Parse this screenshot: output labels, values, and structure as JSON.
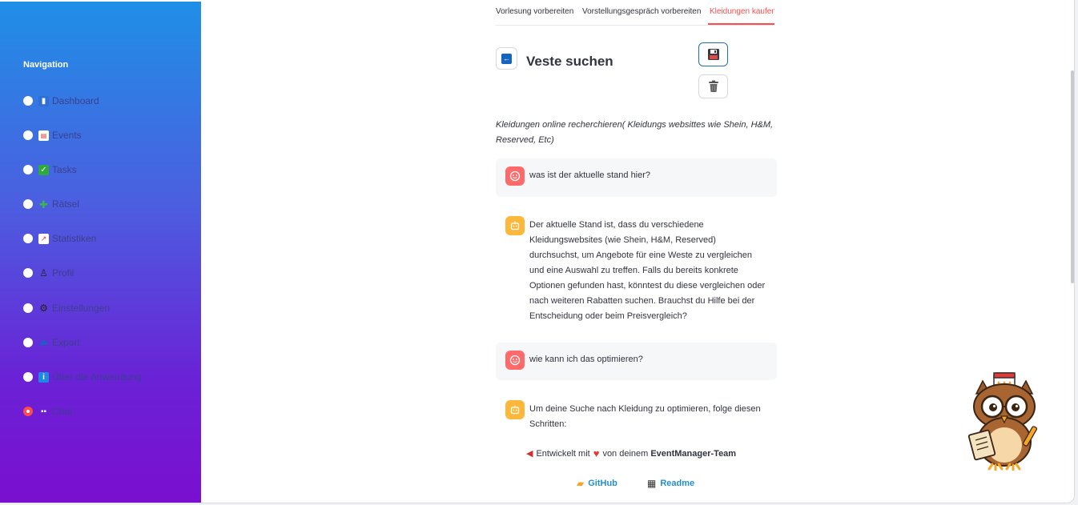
{
  "sidebar": {
    "title": "Navigation",
    "items": [
      {
        "icon": "chart-icon",
        "emoji": "📊",
        "label": "Dashboard",
        "selected": false
      },
      {
        "icon": "calendar-icon",
        "emoji": "📅",
        "label": "Events",
        "selected": false
      },
      {
        "icon": "checkmark-icon",
        "emoji": "✅",
        "label": "Tasks",
        "selected": false
      },
      {
        "icon": "puzzle-icon",
        "emoji": "🧩",
        "label": "Rätsel",
        "selected": false
      },
      {
        "icon": "trend-chart-icon",
        "emoji": "📈",
        "label": "Statistiken",
        "selected": false
      },
      {
        "icon": "user-icon",
        "emoji": "👤",
        "label": "Profil",
        "selected": false
      },
      {
        "icon": "gear-icon",
        "emoji": "⚙",
        "label": "Einstellungen",
        "selected": false
      },
      {
        "icon": "export-icon",
        "emoji": "📤",
        "label": "Export",
        "selected": false
      },
      {
        "icon": "info-icon",
        "emoji": "ℹ",
        "label": "Über die Anwendung",
        "selected": false
      },
      {
        "icon": "chat-icon",
        "emoji": "💬",
        "label": "Chat",
        "selected": true
      }
    ]
  },
  "tabs": [
    {
      "label": "Vorlesung vorbereiten",
      "active": false
    },
    {
      "label": "Vorstellungsgespräch vorbereiten",
      "active": false
    },
    {
      "label": "Kleidungen kaufen",
      "active": true
    }
  ],
  "task": {
    "back_icon": "back-arrow-icon",
    "title": "Veste suchen",
    "description": "Kleidungen online recherchieren( Kleidungs websittes wie Shein, H&M, Reserved, Etc)"
  },
  "chat": {
    "messages": [
      {
        "role": "user",
        "text": "was ist der aktuelle stand hier?"
      },
      {
        "role": "assistant",
        "text": "Der aktuelle Stand ist, dass du verschiedene Kleidungswebsites (wie Shein, H&M, Reserved) durchsuchst, um Angebote für eine Weste zu vergleichen und eine Auswahl zu treffen. Falls du bereits konkrete Optionen gefunden hast, könntest du diese vergleichen oder nach weiteren Rabatten suchen. Brauchst du Hilfe bei der Entscheidung oder beim Preisvergleich?"
      },
      {
        "role": "user",
        "text": "wie kann ich das optimieren?"
      },
      {
        "role": "assistant",
        "text": "Um deine Suche nach Kleidung zu optimieren, folge diesen Schritten:"
      }
    ]
  },
  "footer": {
    "prefix": "Entwickelt mit",
    "middle": "von deinem",
    "team": "EventManager-Team",
    "github": "GitHub",
    "readme": "Readme"
  },
  "colors": {
    "accent": "#ff4b4b",
    "link": "#1f8fd1",
    "sidebar_top": "#1f8fe6",
    "sidebar_bottom": "#7a0fcf"
  }
}
